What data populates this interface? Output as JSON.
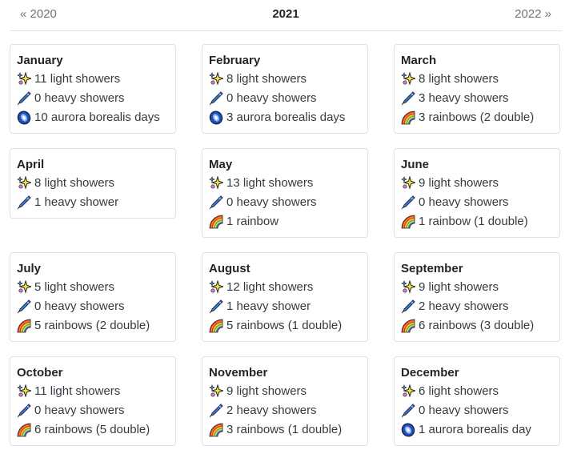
{
  "nav": {
    "prev_label": "« 2020",
    "current_year": "2021",
    "next_label": "2022 »"
  },
  "months": [
    {
      "name": "January",
      "items": [
        {
          "icon": "sparkles-icon",
          "text": "11 light showers"
        },
        {
          "icon": "comet-icon",
          "text": "0 heavy showers"
        },
        {
          "icon": "aurora-icon",
          "text": "10 aurora borealis days"
        }
      ]
    },
    {
      "name": "February",
      "items": [
        {
          "icon": "sparkles-icon",
          "text": "8 light showers"
        },
        {
          "icon": "comet-icon",
          "text": "0 heavy showers"
        },
        {
          "icon": "aurora-icon",
          "text": "3 aurora borealis days"
        }
      ]
    },
    {
      "name": "March",
      "items": [
        {
          "icon": "sparkles-icon",
          "text": "8 light showers"
        },
        {
          "icon": "comet-icon",
          "text": "3 heavy showers"
        },
        {
          "icon": "rainbow-icon",
          "text": "3 rainbows (2 double)"
        }
      ]
    },
    {
      "name": "April",
      "items": [
        {
          "icon": "sparkles-icon",
          "text": "8 light showers"
        },
        {
          "icon": "comet-icon",
          "text": "1 heavy shower"
        }
      ]
    },
    {
      "name": "May",
      "items": [
        {
          "icon": "sparkles-icon",
          "text": "13 light showers"
        },
        {
          "icon": "comet-icon",
          "text": "0 heavy showers"
        },
        {
          "icon": "rainbow-icon",
          "text": "1 rainbow"
        }
      ]
    },
    {
      "name": "June",
      "items": [
        {
          "icon": "sparkles-icon",
          "text": "9 light showers"
        },
        {
          "icon": "comet-icon",
          "text": "0 heavy showers"
        },
        {
          "icon": "rainbow-icon",
          "text": "1 rainbow (1 double)"
        }
      ]
    },
    {
      "name": "July",
      "items": [
        {
          "icon": "sparkles-icon",
          "text": "5 light showers"
        },
        {
          "icon": "comet-icon",
          "text": "0 heavy showers"
        },
        {
          "icon": "rainbow-icon",
          "text": "5 rainbows (2 double)"
        }
      ]
    },
    {
      "name": "August",
      "items": [
        {
          "icon": "sparkles-icon",
          "text": "12 light showers"
        },
        {
          "icon": "comet-icon",
          "text": "1 heavy shower"
        },
        {
          "icon": "rainbow-icon",
          "text": "5 rainbows (1 double)"
        }
      ]
    },
    {
      "name": "September",
      "items": [
        {
          "icon": "sparkles-icon",
          "text": "9 light showers"
        },
        {
          "icon": "comet-icon",
          "text": "2 heavy showers"
        },
        {
          "icon": "rainbow-icon",
          "text": "6 rainbows (3 double)"
        }
      ]
    },
    {
      "name": "October",
      "items": [
        {
          "icon": "sparkles-icon",
          "text": "11 light showers"
        },
        {
          "icon": "comet-icon",
          "text": "0 heavy showers"
        },
        {
          "icon": "rainbow-icon",
          "text": "6 rainbows (5 double)"
        }
      ]
    },
    {
      "name": "November",
      "items": [
        {
          "icon": "sparkles-icon",
          "text": "9 light showers"
        },
        {
          "icon": "comet-icon",
          "text": "2 heavy showers"
        },
        {
          "icon": "rainbow-icon",
          "text": "3 rainbows (1 double)"
        }
      ]
    },
    {
      "name": "December",
      "items": [
        {
          "icon": "sparkles-icon",
          "text": "6 light showers"
        },
        {
          "icon": "comet-icon",
          "text": "0 heavy showers"
        },
        {
          "icon": "aurora-icon",
          "text": "1 aurora borealis day"
        }
      ]
    }
  ]
}
